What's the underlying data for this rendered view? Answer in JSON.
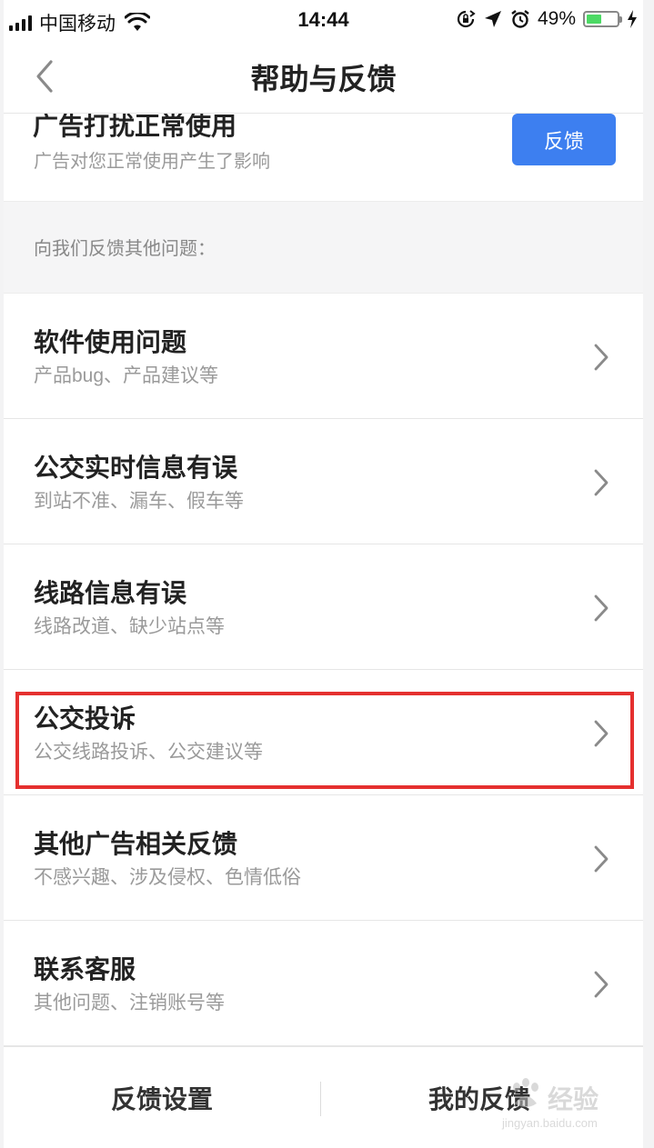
{
  "status_bar": {
    "carrier": "中国移动",
    "time": "14:44",
    "battery_percent": "49%",
    "battery_level": 0.49,
    "icons": [
      "signal-icon",
      "wifi-icon",
      "orientation-lock-icon",
      "location-icon",
      "alarm-icon",
      "battery-icon",
      "charging-icon"
    ]
  },
  "nav": {
    "title": "帮助与反馈",
    "back_icon": "chevron-left-icon"
  },
  "ad_row": {
    "title": "广告打扰正常使用",
    "subtitle": "广告对您正常使用产生了影响",
    "button_label": "反馈",
    "button_color": "#3d7ff0"
  },
  "section_header": "向我们反馈其他问题：",
  "items": [
    {
      "title": "软件使用问题",
      "subtitle": "产品bug、产品建议等"
    },
    {
      "title": "公交实时信息有误",
      "subtitle": "到站不准、漏车、假车等"
    },
    {
      "title": "线路信息有误",
      "subtitle": "线路改道、缺少站点等"
    },
    {
      "title": "公交投诉",
      "subtitle": "公交线路投诉、公交建议等",
      "highlighted": true
    },
    {
      "title": "其他广告相关反馈",
      "subtitle": "不感兴趣、涉及侵权、色情低俗"
    },
    {
      "title": "联系客服",
      "subtitle": "其他问题、注销账号等"
    }
  ],
  "highlight_color": "#e5302f",
  "bottom_bar": {
    "left_label": "反馈设置",
    "right_label": "我的反馈"
  },
  "watermark": {
    "text": "经验",
    "site": "jingyan.baidu.com"
  }
}
